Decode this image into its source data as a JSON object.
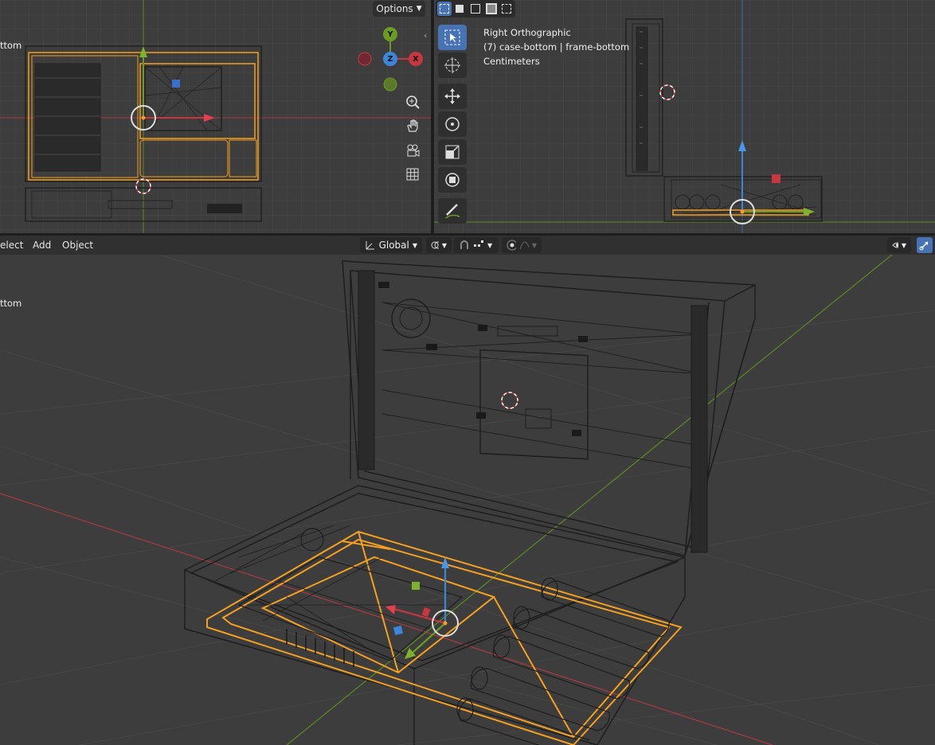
{
  "top_left_viewport": {
    "object_label": "ttom",
    "options_label": "Options",
    "gizmo": {
      "y": "Y",
      "z": "Z",
      "x": "X"
    },
    "nav_icons": [
      "zoom-icon",
      "hand-pan-icon",
      "camera-icon",
      "grid-icon"
    ]
  },
  "top_right_viewport": {
    "view_name": "Right Orthographic",
    "collection_info": "(7) case-bottom | frame-bottom",
    "units": "Centimeters",
    "select_modes": [
      "select-box-icon",
      "select-extend-icon",
      "select-subtract-icon",
      "select-invert-icon",
      "select-intersect-icon"
    ],
    "tools": [
      "select-icon",
      "cursor-icon",
      "move-icon",
      "rotate-icon",
      "scale-icon",
      "transform-icon",
      "annotate-icon"
    ]
  },
  "bottom_viewport": {
    "object_label": "ttom",
    "header": {
      "menu": [
        "elect",
        "Add",
        "Object"
      ],
      "orientation": "Global",
      "icons": [
        "pivot-icon",
        "snap-icon",
        "snap-increment-icon",
        "proportional-icon",
        "falloff-icon",
        "visibility-icon",
        "gizmo-icon"
      ]
    }
  },
  "colors": {
    "viewport_bg": "#3d3d3d",
    "selection_orange": "#f5a020",
    "axis_red": "#c8363f",
    "axis_green": "#6b9b22",
    "axis_blue": "#3a86d9",
    "active_tool": "#4772b3"
  }
}
